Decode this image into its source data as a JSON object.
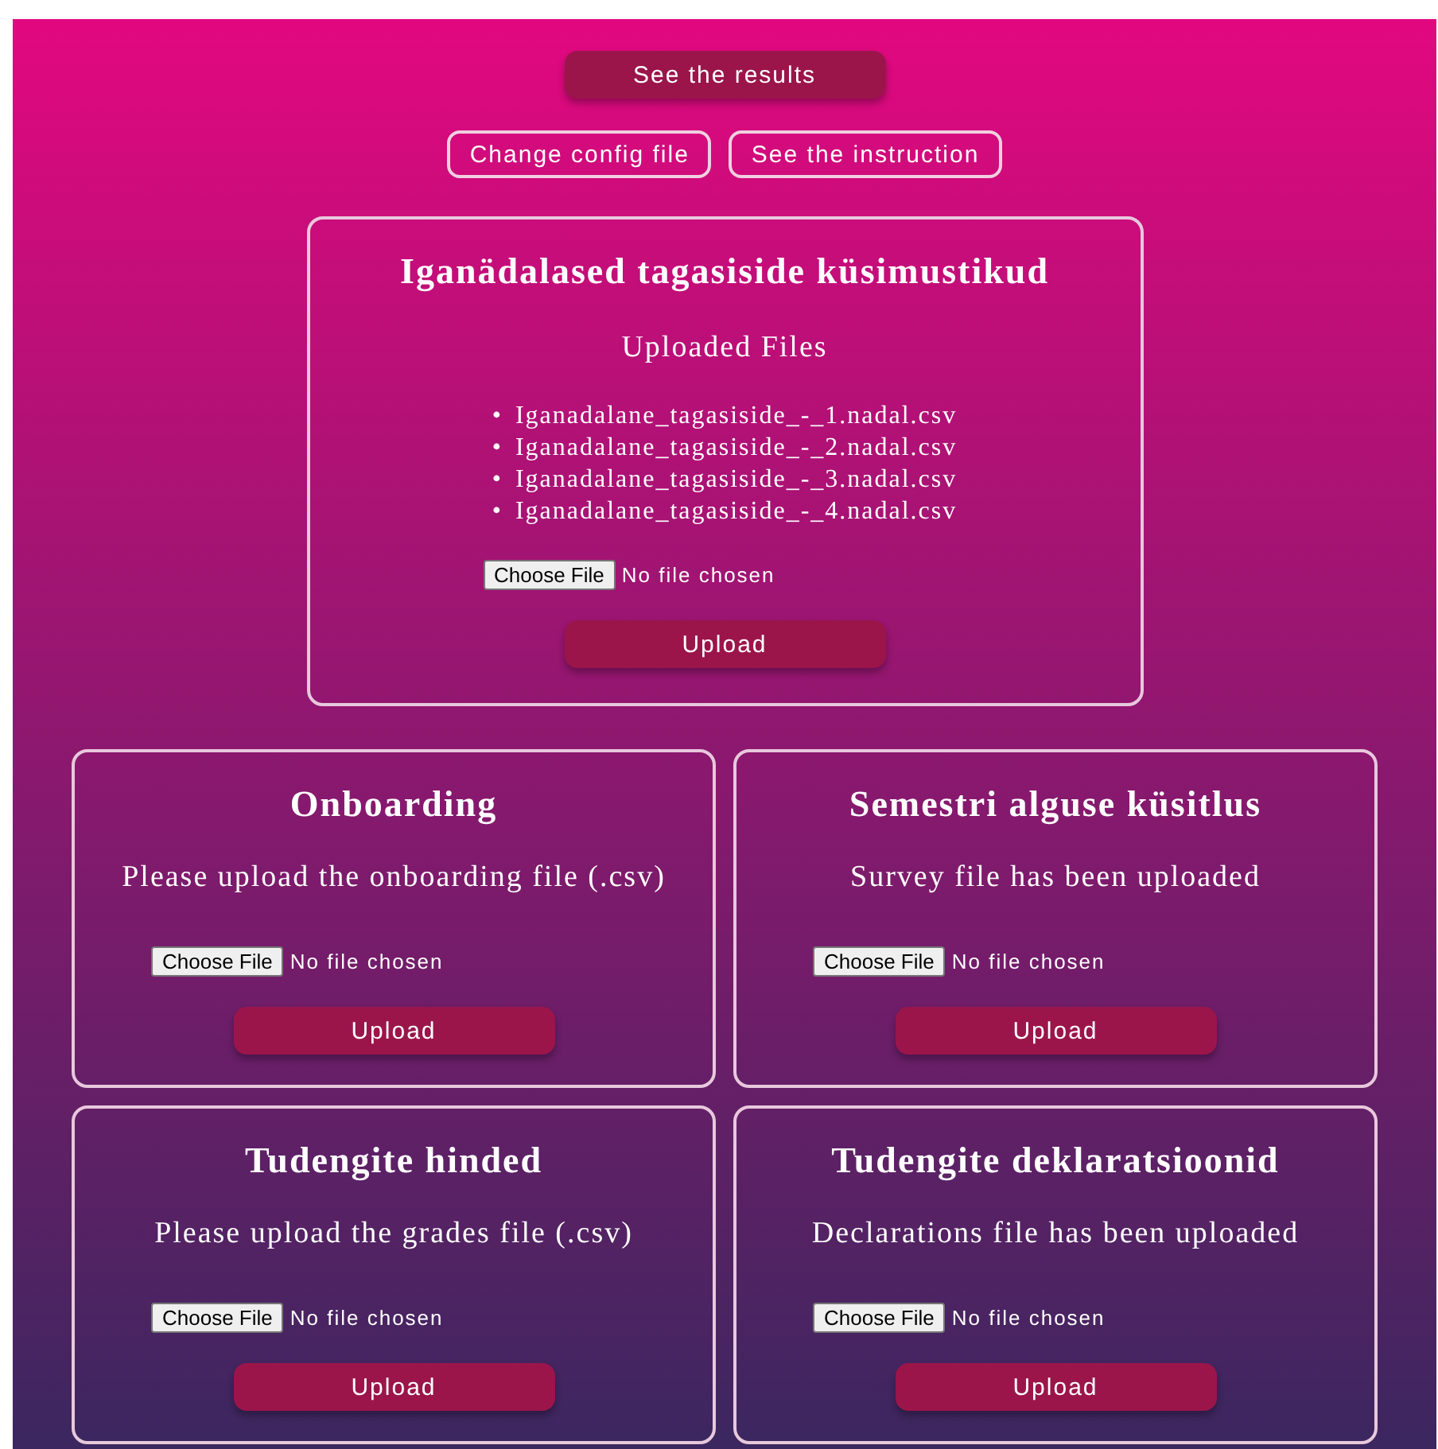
{
  "top_buttons": [
    {
      "label": "See the results",
      "kind": "filled"
    }
  ],
  "secondary_buttons": [
    {
      "label": "Change config file",
      "kind": "outline"
    },
    {
      "label": "See the instruction",
      "kind": "outline"
    }
  ],
  "main_card": {
    "title": "Iganädalased tagasiside küsimustikud",
    "subtitle": "Uploaded Files",
    "files": [
      {
        "marker": "•",
        "name": "Iganadalane_tagasiside_-_1.nadal.csv"
      },
      {
        "marker": "•",
        "name": "Iganadalane_tagasiside_-_2.nadal.csv"
      },
      {
        "marker": "•",
        "name": "Iganadalane_tagasiside_-_3.nadal.csv"
      },
      {
        "marker": "•",
        "name": "Iganadalane_tagasiside_-_4.nadal.csv"
      }
    ],
    "file_input": {
      "button": "Choose File",
      "status": "No file chosen"
    },
    "upload_button": "Upload"
  },
  "cards": [
    {
      "title": "Onboarding",
      "message": "Please upload the onboarding file (.csv)",
      "file_input": {
        "button": "Choose File",
        "status": "No file chosen"
      },
      "upload_button": "Upload"
    },
    {
      "title": "Semestri alguse küsitlus",
      "message": "Survey file has been uploaded",
      "file_input": {
        "button": "Choose File",
        "status": "No file chosen"
      },
      "upload_button": "Upload"
    },
    {
      "title": "Tudengite hinded",
      "message": "Please upload the grades file (.csv)",
      "file_input": {
        "button": "Choose File",
        "status": "No file chosen"
      },
      "upload_button": "Upload"
    },
    {
      "title": "Tudengite deklaratsioonid",
      "message": "Declarations file has been uploaded",
      "file_input": {
        "button": "Choose File",
        "status": "No file chosen"
      },
      "upload_button": "Upload"
    }
  ]
}
